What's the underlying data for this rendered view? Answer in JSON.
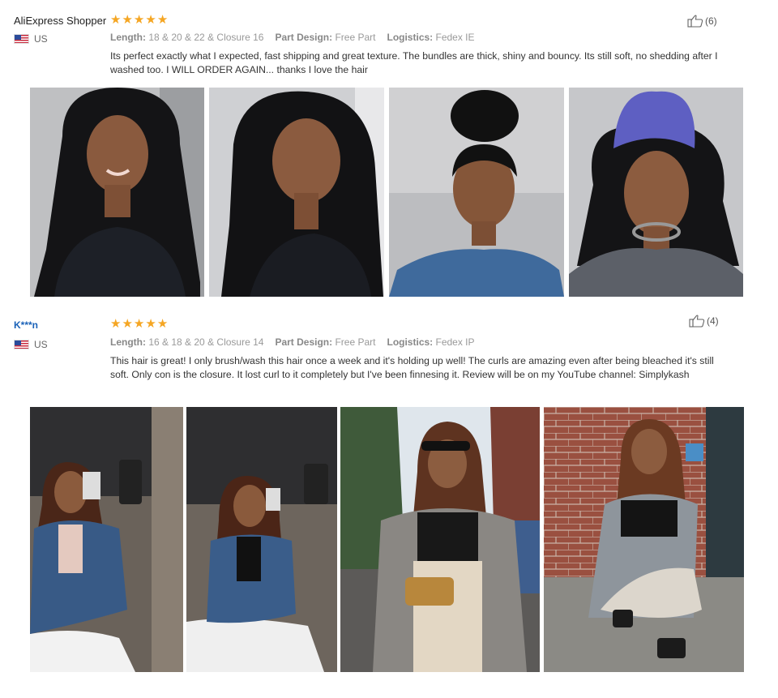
{
  "reviews": [
    {
      "user": "AliExpress Shopper",
      "country": "US",
      "rating": 5,
      "helpful_count": "(6)",
      "attributes": [
        {
          "label": "Length:",
          "value": "18 & 20 & 22 & Closure 16"
        },
        {
          "label": "Part Design:",
          "value": "Free Part"
        },
        {
          "label": "Logistics:",
          "value": "Fedex IE"
        }
      ],
      "text": "Its perfect exactly what I expected, fast shipping and great texture. The bundles are thick, shiny and bouncy. Its still soft, no shedding after I washed too. I WILL ORDER AGAIN... thanks I love the hair"
    },
    {
      "user": "K***n",
      "country": "US",
      "rating": 5,
      "helpful_count": "(4)",
      "attributes": [
        {
          "label": "Length:",
          "value": "16 & 18 & 20 & Closure 14"
        },
        {
          "label": "Part Design:",
          "value": "Free Part"
        },
        {
          "label": "Logistics:",
          "value": "Fedex IP"
        }
      ],
      "text": "This hair is great! I only brush/wash this hair once a week and it's holding up well! The curls are amazing even after being bleached it's still soft. Only con is the closure. It lost curl to it completely but I've been finnesing it. Review will be on my YouTube channel: Simplykash"
    }
  ],
  "colors": {
    "star": "#f5a623",
    "username_link": "#1a62b8"
  }
}
